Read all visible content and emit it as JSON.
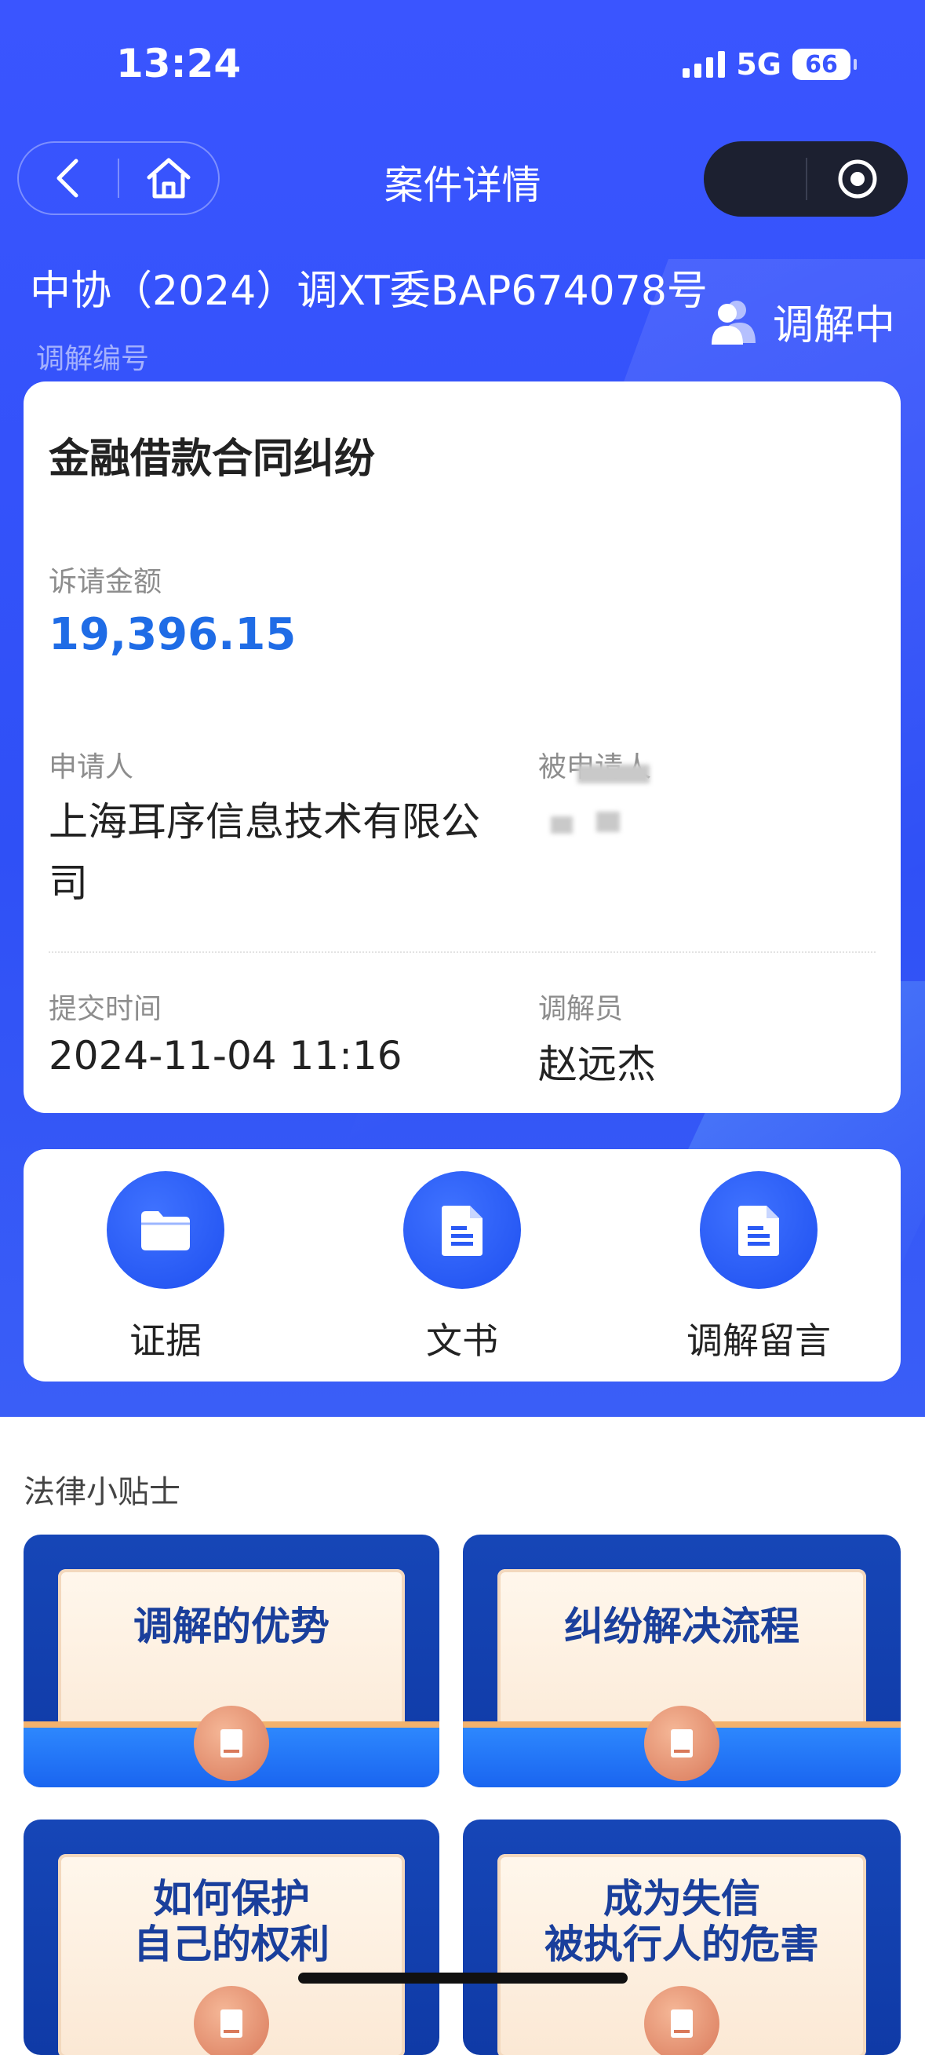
{
  "status_bar": {
    "time": "13:24",
    "network": "5G",
    "battery": "66"
  },
  "nav": {
    "title": "案件详情"
  },
  "case": {
    "number": "中协（2024）调XT委BAP674078号",
    "number_label": "调解编号",
    "status": "调解中"
  },
  "detail": {
    "title": "金融借款合同纠纷",
    "amount_label": "诉请金额",
    "amount": "19,396.15",
    "applicant_label": "申请人",
    "applicant": "上海耳序信息技术有限公司",
    "respondent_label": "被申请人",
    "submit_time_label": "提交时间",
    "submit_time": "2024-11-04 11:16",
    "mediator_label": "调解员",
    "mediator": "赵远杰"
  },
  "actions": [
    {
      "label": "证据",
      "icon": "folder-icon"
    },
    {
      "label": "文书",
      "icon": "document-icon"
    },
    {
      "label": "调解留言",
      "icon": "document-icon"
    }
  ],
  "tips": {
    "title": "法律小贴士",
    "items": [
      {
        "line1": "调解的优势",
        "line2": ""
      },
      {
        "line1": "纠纷解决流程",
        "line2": ""
      },
      {
        "line1": "如何保护",
        "line2": "自己的权利"
      },
      {
        "line1": "成为失信",
        "line2": "被执行人的危害"
      }
    ]
  },
  "colors": {
    "primary": "#3a55ff",
    "amount": "#1f6ce6",
    "tip_text": "#1a3f9c"
  }
}
